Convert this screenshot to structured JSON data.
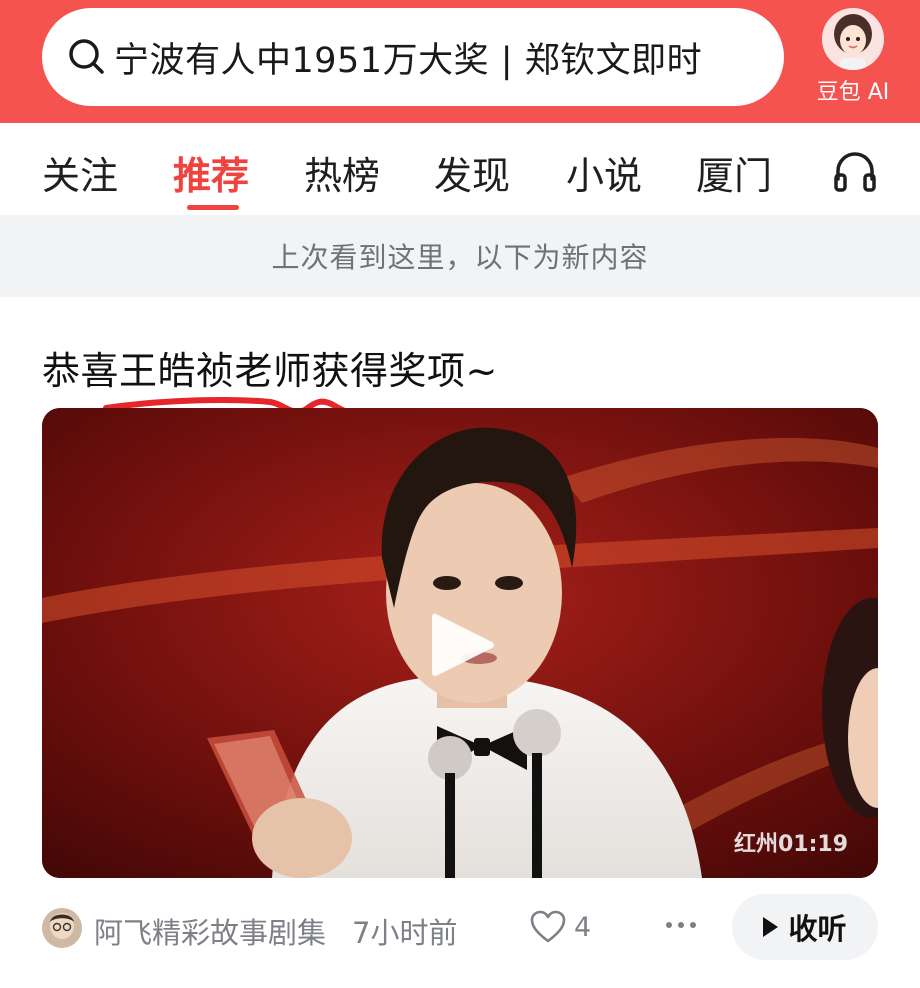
{
  "header": {
    "search_text": "宁波有人中1951万大奖 | 郑钦文即时",
    "ai_label": "豆包 AI"
  },
  "tabs": [
    {
      "label": "关注",
      "active": false
    },
    {
      "label": "推荐",
      "active": true
    },
    {
      "label": "热榜",
      "active": false
    },
    {
      "label": "发现",
      "active": false
    },
    {
      "label": "小说",
      "active": false
    },
    {
      "label": "厦门",
      "active": false
    }
  ],
  "notice": "上次看到这里，以下为新内容",
  "post": {
    "title": "恭喜王皓祯老师获得奖项~",
    "video_watermark": "红州01:19",
    "author": "阿飞精彩故事剧集",
    "time": "7小时前",
    "likes": "4",
    "listen_label": "收听"
  },
  "colors": {
    "brand": "#f5534f",
    "active_tab": "#f0433f",
    "muted_text": "#7d8087",
    "notice_bg": "#f2f3f5"
  },
  "icons": [
    "search-icon",
    "ai-avatar-icon",
    "headphone-icon",
    "play-icon",
    "heart-icon",
    "more-icon",
    "play-small-icon"
  ]
}
